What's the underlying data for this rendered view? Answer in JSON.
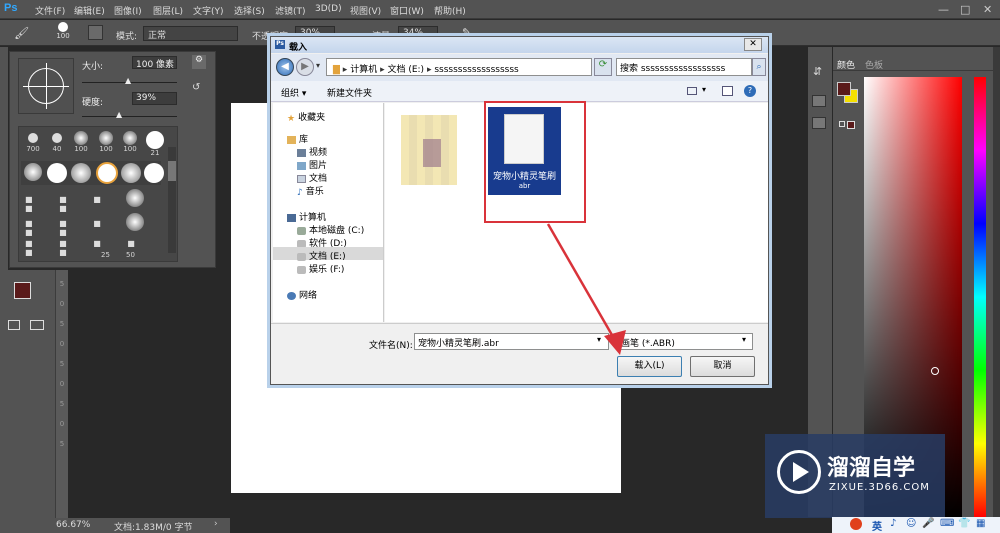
{
  "menubar": {
    "logo": "Ps",
    "items": [
      "文件(F)",
      "编辑(E)",
      "图像(I)",
      "图层(L)",
      "文字(Y)",
      "选择(S)",
      "滤镜(T)",
      "3D(D)",
      "视图(V)",
      "窗口(W)",
      "帮助(H)"
    ],
    "window_controls": [
      "—",
      "□",
      "✕"
    ]
  },
  "options": {
    "brush_size": "100",
    "mode_label": "模式:",
    "mode_value": "正常",
    "opacity_label": "不透明度:",
    "opacity_value": "30%",
    "flow_label": "流量:",
    "flow_value": "34%"
  },
  "brush_panel": {
    "size_label": "大小:",
    "size_value": "100 像素",
    "hardness_label": "硬度:",
    "hardness_value": "39%",
    "preset_row1": [
      "700",
      "40",
      "100",
      "100",
      "100",
      "21"
    ],
    "preset_row5": [
      "25",
      "50"
    ]
  },
  "ruler_marks": [
    "5",
    "0",
    "5",
    "0",
    "5",
    "0",
    "5",
    "0",
    "5"
  ],
  "status": {
    "zoom": "66.67%",
    "doc": "文档:1.83M/0 字节"
  },
  "color_panel": {
    "tab_color": "颜色",
    "tab_swatches": "色板",
    "foreground": "#5a1a1a",
    "background": "#f5e000"
  },
  "dialog": {
    "title": "载入",
    "close": "✕",
    "breadcrumb": [
      "计算机",
      "文档 (E:)",
      "ssssssssssssssssss"
    ],
    "search_placeholder": "搜索 ssssssssssssssssss",
    "toolbar": {
      "organize": "组织 ▾",
      "new_folder": "新建文件夹"
    },
    "nav": {
      "favorites": "收藏夹",
      "library": "库",
      "library_items": [
        "视频",
        "图片",
        "文档",
        "音乐"
      ],
      "computer": "计算机",
      "drives": [
        "本地磁盘 (C:)",
        "软件 (D:)",
        "文档 (E:)",
        "娱乐 (F:)"
      ],
      "network": "网络"
    },
    "file": {
      "name_line1": "宠物小精灵笔刷",
      "name_line2": "abr"
    },
    "filename_label": "文件名(N):",
    "filename_value": "宠物小精灵笔刷.abr",
    "filetype_value": "画笔 (*.ABR)",
    "load_button": "载入(L)",
    "cancel_button": "取消"
  },
  "watermark": {
    "title": "溜溜自学",
    "subtitle": "ZIXUE.3D66.COM"
  },
  "taskbar": {
    "ime": "英"
  }
}
